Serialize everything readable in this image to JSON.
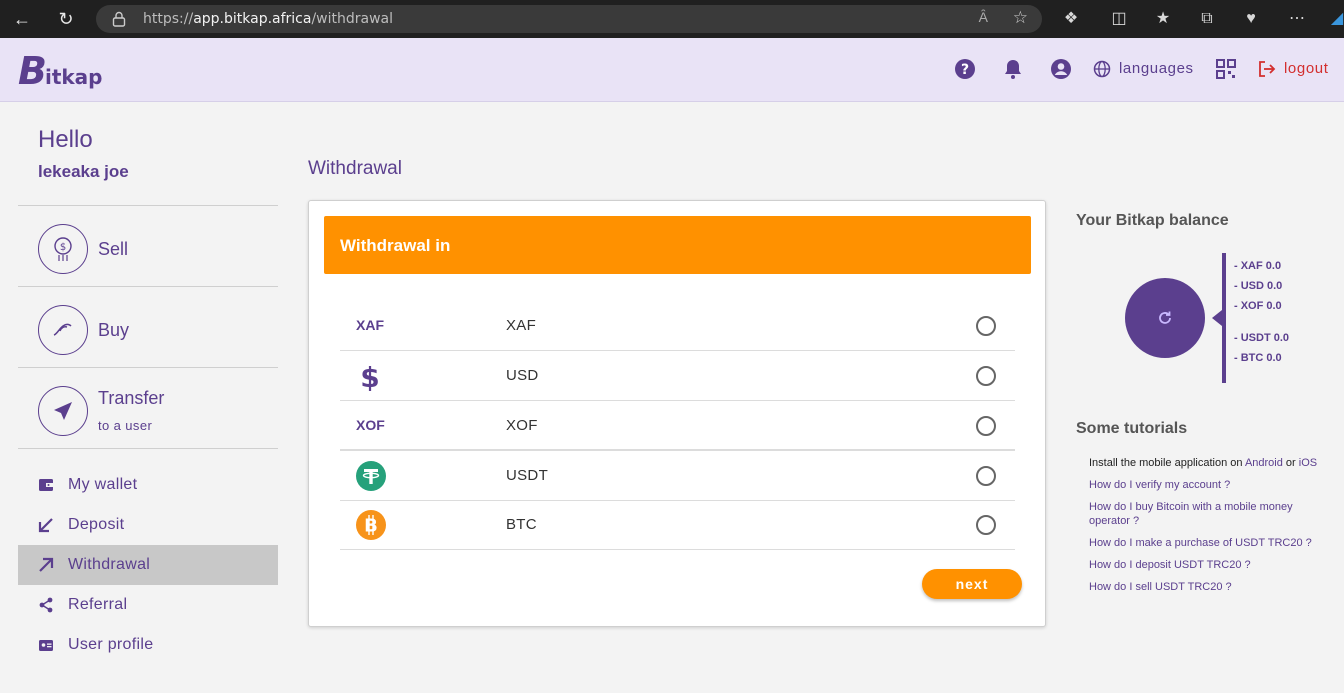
{
  "browser": {
    "url_prefix": "https://",
    "url_host": "app.bitkap.africa",
    "url_path": "/withdrawal",
    "reader_label": "Ȃ"
  },
  "header": {
    "logo_big": "B",
    "logo_rest": "itkap",
    "languages_label": "languages",
    "logout_label": "logout",
    "accent_color": "#5b3f8e",
    "logout_color": "#d32f2f"
  },
  "sidebar": {
    "greeting": "Hello",
    "username": "lekeaka joe",
    "main_items": [
      {
        "label": "Sell",
        "icon": "sell-coin-icon"
      },
      {
        "label": "Buy",
        "icon": "buy-hand-icon"
      },
      {
        "label": "Transfer",
        "sub": "to a user",
        "icon": "send-icon"
      }
    ],
    "items": [
      {
        "label": "My wallet",
        "icon": "wallet-icon"
      },
      {
        "label": "Deposit",
        "icon": "arrow-down-left-icon"
      },
      {
        "label": "Withdrawal",
        "icon": "arrow-up-right-icon",
        "active": true
      },
      {
        "label": "Referral",
        "icon": "share-icon"
      },
      {
        "label": "User profile",
        "icon": "id-card-icon"
      }
    ]
  },
  "main": {
    "title": "Withdrawal",
    "banner": "Withdrawal in",
    "currencies": [
      {
        "code": "XAF",
        "name": "XAF",
        "icon": "xaf-text"
      },
      {
        "code": "USD",
        "name": "USD",
        "icon": "dollar-icon"
      },
      {
        "code": "XOF",
        "name": "XOF",
        "icon": "xof-text"
      },
      {
        "code": "USDT",
        "name": "USDT",
        "icon": "tether-icon"
      },
      {
        "code": "BTC",
        "name": "BTC",
        "icon": "bitcoin-icon"
      }
    ],
    "next_label": "next",
    "button_color": "#ff9100"
  },
  "balance": {
    "title": "Your Bitkap balance",
    "items": [
      "- XAF 0.0",
      "- USD 0.0",
      "- XOF 0.0",
      "- USDT 0.0",
      "- BTC 0.0"
    ]
  },
  "tutorials": {
    "title": "Some tutorials",
    "install_prefix": "Install the mobile application on",
    "android": "Android",
    "or": "or",
    "ios": "iOS",
    "links": [
      "How do I verify my account ?",
      "How do I buy Bitcoin with a mobile money operator ?",
      "How do I make a purchase of USDT TRC20 ?",
      "How do I deposit USDT TRC20 ?",
      "How do I sell USDT TRC20 ?"
    ]
  }
}
